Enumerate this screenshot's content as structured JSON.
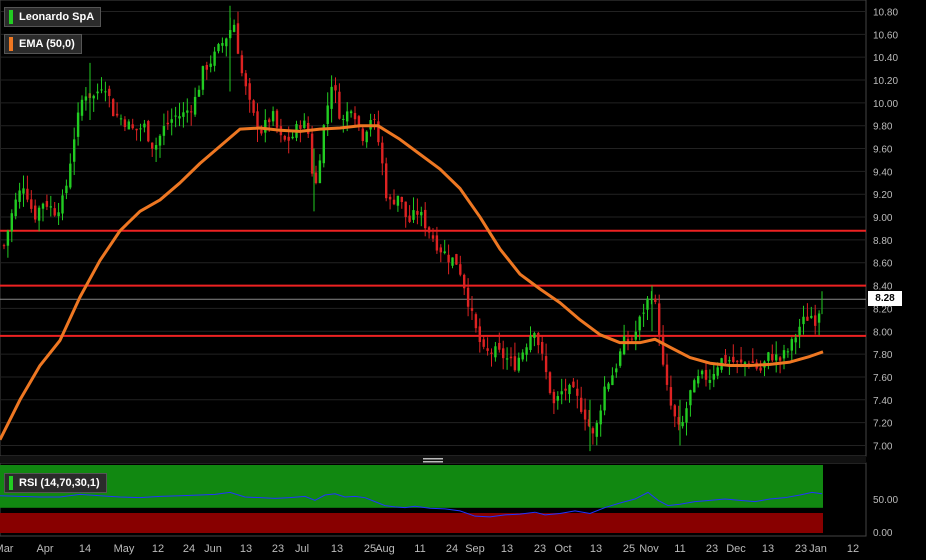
{
  "instrument": "Leonardo SpA",
  "indicators": {
    "ema_label": "EMA (50,0)",
    "rsi_label": "RSI (14,70,30,1)"
  },
  "last_price_label": "8.28",
  "colors": {
    "background": "#000000",
    "up_candle": "#22cc22",
    "down_candle": "#dd2222",
    "ema": "#ee7722",
    "resistance": "#ee2222",
    "rsi_line": "#2233ff",
    "rsi_overbought_zone": "#118811",
    "rsi_oversold_zone": "#880000",
    "grid": "#222222",
    "axis_text": "#bbbbbb"
  },
  "chart_data": [
    {
      "type": "candlestick",
      "title": "Leonardo SpA",
      "y_ticks": [
        "10.80",
        "10.60",
        "10.40",
        "10.20",
        "10.00",
        "9.80",
        "9.60",
        "9.40",
        "9.20",
        "9.00",
        "8.80",
        "8.60",
        "8.40",
        "8.20",
        "8.00",
        "7.80",
        "7.60",
        "7.40",
        "7.20",
        "7.00"
      ],
      "ylim": [
        6.9,
        10.9
      ],
      "x_ticks": [
        "Mar",
        "Apr",
        "14",
        "May",
        "12",
        "24",
        "Jun",
        "13",
        "23",
        "Jul",
        "13",
        "25",
        "Aug",
        "11",
        "24",
        "Sep",
        "13",
        "23",
        "Oct",
        "13",
        "25",
        "Nov",
        "11",
        "23",
        "Dec",
        "13",
        "23",
        "Jan",
        "12"
      ],
      "horizontal_lines": [
        8.88,
        8.4,
        7.96
      ],
      "last_price": 8.28,
      "ema_50": [
        [
          0,
          7.05
        ],
        [
          20,
          7.4
        ],
        [
          40,
          7.7
        ],
        [
          60,
          7.92
        ],
        [
          80,
          8.3
        ],
        [
          100,
          8.62
        ],
        [
          120,
          8.88
        ],
        [
          140,
          9.05
        ],
        [
          160,
          9.15
        ],
        [
          180,
          9.3
        ],
        [
          200,
          9.47
        ],
        [
          220,
          9.62
        ],
        [
          240,
          9.77
        ],
        [
          260,
          9.78
        ],
        [
          280,
          9.76
        ],
        [
          300,
          9.75
        ],
        [
          320,
          9.77
        ],
        [
          340,
          9.78
        ],
        [
          360,
          9.8
        ],
        [
          378,
          9.8
        ],
        [
          400,
          9.68
        ],
        [
          420,
          9.55
        ],
        [
          440,
          9.42
        ],
        [
          460,
          9.25
        ],
        [
          480,
          9.0
        ],
        [
          500,
          8.72
        ],
        [
          520,
          8.5
        ],
        [
          540,
          8.37
        ],
        [
          560,
          8.25
        ],
        [
          580,
          8.1
        ],
        [
          600,
          7.97
        ],
        [
          620,
          7.9
        ],
        [
          640,
          7.9
        ],
        [
          655,
          7.93
        ],
        [
          670,
          7.86
        ],
        [
          690,
          7.77
        ],
        [
          710,
          7.72
        ],
        [
          730,
          7.7
        ],
        [
          750,
          7.7
        ],
        [
          770,
          7.71
        ],
        [
          790,
          7.73
        ],
        [
          810,
          7.78
        ],
        [
          823,
          7.82
        ]
      ],
      "price_path": [
        [
          4,
          8.75
        ],
        [
          14,
          9.1
        ],
        [
          24,
          9.3
        ],
        [
          34,
          9.0
        ],
        [
          44,
          9.15
        ],
        [
          54,
          9.05
        ],
        [
          64,
          9.15
        ],
        [
          74,
          9.7
        ],
        [
          84,
          10.1
        ],
        [
          94,
          10.05
        ],
        [
          104,
          10.2
        ],
        [
          114,
          9.9
        ],
        [
          124,
          9.85
        ],
        [
          134,
          9.75
        ],
        [
          144,
          9.8
        ],
        [
          154,
          9.6
        ],
        [
          164,
          9.78
        ],
        [
          174,
          9.88
        ],
        [
          184,
          9.9
        ],
        [
          194,
          10.0
        ],
        [
          204,
          10.3
        ],
        [
          214,
          10.4
        ],
        [
          224,
          10.55
        ],
        [
          234,
          10.7
        ],
        [
          242,
          10.25
        ],
        [
          252,
          9.9
        ],
        [
          262,
          9.75
        ],
        [
          272,
          9.9
        ],
        [
          282,
          9.65
        ],
        [
          292,
          9.7
        ],
        [
          302,
          9.85
        ],
        [
          310,
          9.7
        ],
        [
          314,
          9.15
        ],
        [
          322,
          9.7
        ],
        [
          332,
          10.2
        ],
        [
          342,
          9.82
        ],
        [
          352,
          10.0
        ],
        [
          362,
          9.7
        ],
        [
          372,
          9.9
        ],
        [
          380,
          9.6
        ],
        [
          388,
          9.1
        ],
        [
          398,
          9.2
        ],
        [
          408,
          8.95
        ],
        [
          418,
          9.05
        ],
        [
          428,
          8.9
        ],
        [
          438,
          8.75
        ],
        [
          448,
          8.65
        ],
        [
          458,
          8.6
        ],
        [
          466,
          8.35
        ],
        [
          474,
          8.05
        ],
        [
          484,
          7.8
        ],
        [
          494,
          7.82
        ],
        [
          504,
          7.78
        ],
        [
          514,
          7.7
        ],
        [
          524,
          7.85
        ],
        [
          534,
          8.05
        ],
        [
          544,
          7.7
        ],
        [
          554,
          7.35
        ],
        [
          564,
          7.5
        ],
        [
          574,
          7.45
        ],
        [
          584,
          7.3
        ],
        [
          594,
          7.05
        ],
        [
          604,
          7.5
        ],
        [
          614,
          7.65
        ],
        [
          624,
          7.9
        ],
        [
          634,
          7.95
        ],
        [
          644,
          8.2
        ],
        [
          652,
          8.35
        ],
        [
          658,
          8.1
        ],
        [
          664,
          7.6
        ],
        [
          672,
          7.3
        ],
        [
          680,
          7.1
        ],
        [
          690,
          7.45
        ],
        [
          700,
          7.6
        ],
        [
          710,
          7.6
        ],
        [
          720,
          7.75
        ],
        [
          730,
          7.75
        ],
        [
          740,
          7.7
        ],
        [
          750,
          7.75
        ],
        [
          760,
          7.65
        ],
        [
          770,
          7.8
        ],
        [
          780,
          7.75
        ],
        [
          790,
          7.85
        ],
        [
          800,
          8.05
        ],
        [
          810,
          8.15
        ],
        [
          816,
          8.1
        ],
        [
          822,
          8.28
        ]
      ],
      "wick_range_by_x": [
        [
          90,
          9.85,
          10.35
        ],
        [
          230,
          10.1,
          10.85
        ],
        [
          314,
          9.05,
          9.6
        ],
        [
          590,
          6.95,
          7.4
        ],
        [
          652,
          8.0,
          8.4
        ],
        [
          680,
          7.0,
          7.4
        ],
        [
          822,
          8.15,
          8.35
        ]
      ]
    },
    {
      "type": "line",
      "title": "RSI (14,70,30,1)",
      "y_ticks": [
        "50.00",
        "0.00"
      ],
      "ylim": [
        0,
        100
      ],
      "overbought": 70,
      "oversold": 30,
      "values": [
        [
          0,
          55
        ],
        [
          20,
          54
        ],
        [
          40,
          53
        ],
        [
          60,
          53
        ],
        [
          80,
          57
        ],
        [
          100,
          55
        ],
        [
          120,
          53
        ],
        [
          140,
          52
        ],
        [
          160,
          54
        ],
        [
          180,
          55
        ],
        [
          200,
          56
        ],
        [
          215,
          57
        ],
        [
          230,
          60
        ],
        [
          245,
          53
        ],
        [
          260,
          52
        ],
        [
          275,
          51
        ],
        [
          290,
          52
        ],
        [
          305,
          54
        ],
        [
          315,
          48
        ],
        [
          325,
          56
        ],
        [
          335,
          58
        ],
        [
          345,
          53
        ],
        [
          355,
          54
        ],
        [
          365,
          52
        ],
        [
          375,
          46
        ],
        [
          385,
          40
        ],
        [
          395,
          38
        ],
        [
          405,
          37
        ],
        [
          415,
          39
        ],
        [
          430,
          36
        ],
        [
          445,
          35
        ],
        [
          460,
          32
        ],
        [
          475,
          24
        ],
        [
          490,
          23
        ],
        [
          505,
          26
        ],
        [
          520,
          27
        ],
        [
          535,
          30
        ],
        [
          545,
          26
        ],
        [
          560,
          28
        ],
        [
          575,
          32
        ],
        [
          590,
          28
        ],
        [
          605,
          37
        ],
        [
          620,
          44
        ],
        [
          635,
          50
        ],
        [
          648,
          60
        ],
        [
          658,
          48
        ],
        [
          668,
          40
        ],
        [
          680,
          42
        ],
        [
          695,
          46
        ],
        [
          710,
          48
        ],
        [
          725,
          50
        ],
        [
          740,
          48
        ],
        [
          755,
          46
        ],
        [
          770,
          50
        ],
        [
          785,
          52
        ],
        [
          800,
          56
        ],
        [
          812,
          60
        ],
        [
          822,
          58
        ]
      ]
    }
  ]
}
